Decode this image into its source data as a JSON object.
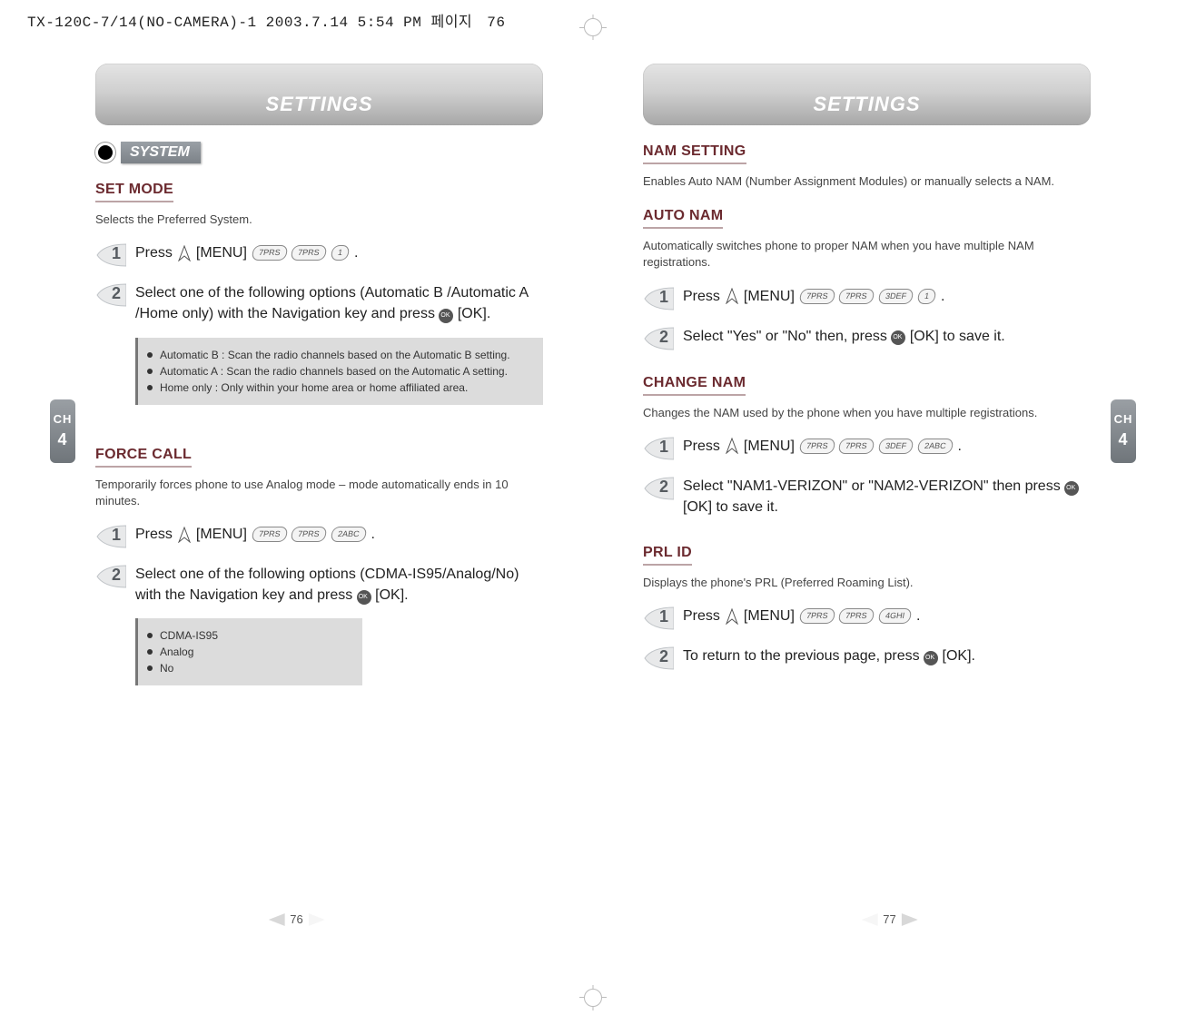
{
  "meta": {
    "file_stamp": "TX-120C-7/14(NO-CAMERA)-1  2003.7.14 5:54 PM",
    "page_word": "페이지",
    "page_no": "76"
  },
  "left": {
    "title": "SETTINGS",
    "system_label": "SYSTEM",
    "side_tab": {
      "ch": "CH",
      "num": "4"
    },
    "page_number": "76",
    "set_mode": {
      "heading": "SET MODE",
      "desc": "Selects the Preferred System.",
      "step1_prefix": "Press",
      "step1_menu": "[MENU]",
      "step1_keys": [
        "7PRS",
        "7PRS",
        "1"
      ],
      "step2": "Select one of the following options (Automatic B /Automatic A /Home only) with the Navigation key and press",
      "step2_ok": "[OK].",
      "notes": [
        "Automatic B : Scan the radio channels based on the Automatic B setting.",
        "Automatic A : Scan the radio channels based on the Automatic A setting.",
        "Home only : Only within your home area or home affiliated area."
      ]
    },
    "force_call": {
      "heading": "FORCE CALL",
      "desc": "Temporarily forces phone to use Analog mode – mode automatically ends in 10 minutes.",
      "step1_prefix": "Press",
      "step1_menu": "[MENU]",
      "step1_keys": [
        "7PRS",
        "7PRS",
        "2ABC"
      ],
      "step2": "Select one of the following options (CDMA-IS95/Analog/No) with the Navigation key and press",
      "step2_ok": "[OK].",
      "notes": [
        "CDMA-IS95",
        "Analog",
        "No"
      ]
    }
  },
  "right": {
    "title": "SETTINGS",
    "side_tab": {
      "ch": "CH",
      "num": "4"
    },
    "page_number": "77",
    "nam_setting": {
      "heading": "NAM SETTING",
      "desc": "Enables Auto NAM (Number Assignment Modules) or manually selects a NAM."
    },
    "auto_nam": {
      "heading": "AUTO NAM",
      "desc": "Automatically switches phone to proper NAM when you have multiple NAM registrations.",
      "step1_prefix": "Press",
      "step1_menu": "[MENU]",
      "step1_keys": [
        "7PRS",
        "7PRS",
        "3DEF",
        "1"
      ],
      "step2_a": "Select \"Yes\" or \"No\" then, press",
      "step2_b": "[OK] to save it."
    },
    "change_nam": {
      "heading": "CHANGE NAM",
      "desc": "Changes the NAM used by the phone when you have multiple registrations.",
      "step1_prefix": "Press",
      "step1_menu": "[MENU]",
      "step1_keys": [
        "7PRS",
        "7PRS",
        "3DEF",
        "2ABC"
      ],
      "step2_a": "Select \"NAM1-VERIZON\" or \"NAM2-VERIZON\" then press",
      "step2_b": "[OK] to save it."
    },
    "prl_id": {
      "heading": "PRL ID",
      "desc": "Displays the phone's PRL (Preferred Roaming List).",
      "step1_prefix": "Press",
      "step1_menu": "[MENU]",
      "step1_keys": [
        "7PRS",
        "7PRS",
        "4GHI"
      ],
      "step2_a": "To return to the previous page, press",
      "step2_b": "[OK]."
    }
  }
}
